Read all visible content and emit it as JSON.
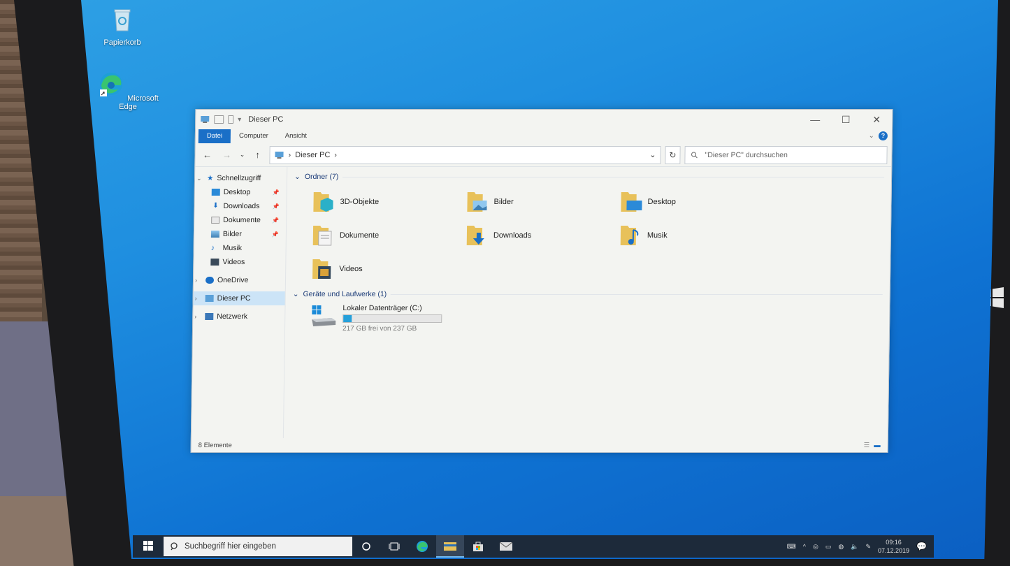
{
  "desktop": {
    "icons": [
      {
        "label": "Papierkorb",
        "icon": "recycle-bin-icon"
      },
      {
        "label": "Microsoft Edge",
        "icon": "edge-icon"
      }
    ]
  },
  "window": {
    "title": "Dieser PC",
    "ribbon_tabs": [
      "Datei",
      "Computer",
      "Ansicht"
    ],
    "address": "Dieser PC",
    "search_placeholder": "\"Dieser PC\" durchsuchen",
    "controls": {
      "minimize": "—",
      "maximize": "☐",
      "close": "✕"
    }
  },
  "navpane": {
    "quick_access": "Schnellzugriff",
    "quick_items": [
      {
        "label": "Desktop",
        "pinned": true
      },
      {
        "label": "Downloads",
        "pinned": true
      },
      {
        "label": "Dokumente",
        "pinned": true
      },
      {
        "label": "Bilder",
        "pinned": true
      },
      {
        "label": "Musik",
        "pinned": false
      },
      {
        "label": "Videos",
        "pinned": false
      }
    ],
    "onedrive": "OneDrive",
    "this_pc": "Dieser PC",
    "network": "Netzwerk"
  },
  "content": {
    "folders_header": "Ordner (7)",
    "folders": [
      "3D-Objekte",
      "Bilder",
      "Desktop",
      "Dokumente",
      "Downloads",
      "Musik",
      "Videos"
    ],
    "drives_header": "Geräte und Laufwerke (1)",
    "drive": {
      "name": "Lokaler Datenträger (C:)",
      "free_text": "217 GB frei von 237 GB",
      "used_fraction": 0.084
    }
  },
  "status": {
    "items": "8 Elemente"
  },
  "taskbar": {
    "search_placeholder": "Suchbegriff hier eingeben",
    "time": "09:16",
    "date": "07.12.2019"
  },
  "colors": {
    "accent": "#1a6fc7",
    "desktop": "#1f8fe0",
    "taskbar": "#1d2a3a",
    "drive_fill": "#26a0da"
  }
}
